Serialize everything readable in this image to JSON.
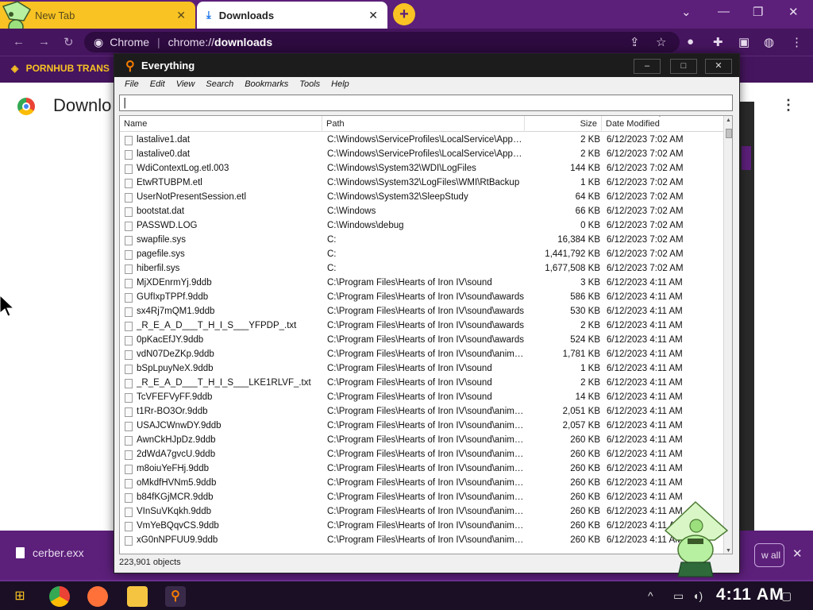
{
  "browser": {
    "tabs": [
      {
        "label": "New Tab"
      },
      {
        "label": "Downloads"
      }
    ],
    "omnibox": {
      "scheme_label": "Chrome",
      "url_prefix": "chrome://",
      "url_host": "downloads"
    },
    "bookmark_label": "PORNHUB TRANS",
    "page_title": "Downlo",
    "download_shelf": {
      "filename": "cerber.exx",
      "show_all_label": "w all"
    }
  },
  "everything": {
    "title": "Everything",
    "menu": [
      "File",
      "Edit",
      "View",
      "Search",
      "Bookmarks",
      "Tools",
      "Help"
    ],
    "search_value": "",
    "columns": {
      "name": "Name",
      "path": "Path",
      "size": "Size",
      "date": "Date Modified"
    },
    "rows": [
      {
        "name": "lastalive1.dat",
        "path": "C:\\Windows\\ServiceProfiles\\LocalService\\AppDat...",
        "size": "2 KB",
        "date": "6/12/2023 7:02 AM"
      },
      {
        "name": "lastalive0.dat",
        "path": "C:\\Windows\\ServiceProfiles\\LocalService\\AppDat...",
        "size": "2 KB",
        "date": "6/12/2023 7:02 AM"
      },
      {
        "name": "WdiContextLog.etl.003",
        "path": "C:\\Windows\\System32\\WDI\\LogFiles",
        "size": "144 KB",
        "date": "6/12/2023 7:02 AM"
      },
      {
        "name": "EtwRTUBPM.etl",
        "path": "C:\\Windows\\System32\\LogFiles\\WMI\\RtBackup",
        "size": "1 KB",
        "date": "6/12/2023 7:02 AM"
      },
      {
        "name": "UserNotPresentSession.etl",
        "path": "C:\\Windows\\System32\\SleepStudy",
        "size": "64 KB",
        "date": "6/12/2023 7:02 AM"
      },
      {
        "name": "bootstat.dat",
        "path": "C:\\Windows",
        "size": "66 KB",
        "date": "6/12/2023 7:02 AM"
      },
      {
        "name": "PASSWD.LOG",
        "path": "C:\\Windows\\debug",
        "size": "0 KB",
        "date": "6/12/2023 7:02 AM"
      },
      {
        "name": "swapfile.sys",
        "path": "C:",
        "size": "16,384 KB",
        "date": "6/12/2023 7:02 AM"
      },
      {
        "name": "pagefile.sys",
        "path": "C:",
        "size": "1,441,792 KB",
        "date": "6/12/2023 7:02 AM"
      },
      {
        "name": "hiberfil.sys",
        "path": "C:",
        "size": "1,677,508 KB",
        "date": "6/12/2023 7:02 AM"
      },
      {
        "name": "MjXDEnrmYj.9ddb",
        "path": "C:\\Program Files\\Hearts of Iron IV\\sound",
        "size": "3 KB",
        "date": "6/12/2023 4:11 AM"
      },
      {
        "name": "GUfIxpTPPf.9ddb",
        "path": "C:\\Program Files\\Hearts of Iron IV\\sound\\awards",
        "size": "586 KB",
        "date": "6/12/2023 4:11 AM"
      },
      {
        "name": "sx4Rj7mQM1.9ddb",
        "path": "C:\\Program Files\\Hearts of Iron IV\\sound\\awards",
        "size": "530 KB",
        "date": "6/12/2023 4:11 AM"
      },
      {
        "name": "_R_E_A_D___T_H_I_S___YFPDP_.txt",
        "path": "C:\\Program Files\\Hearts of Iron IV\\sound\\awards",
        "size": "2 KB",
        "date": "6/12/2023 4:11 AM"
      },
      {
        "name": "0pKacEfJY.9ddb",
        "path": "C:\\Program Files\\Hearts of Iron IV\\sound\\awards",
        "size": "524 KB",
        "date": "6/12/2023 4:11 AM"
      },
      {
        "name": "vdN07DeZKp.9ddb",
        "path": "C:\\Program Files\\Hearts of Iron IV\\sound\\animati...",
        "size": "1,781 KB",
        "date": "6/12/2023 4:11 AM"
      },
      {
        "name": "bSpLpuyNeX.9ddb",
        "path": "C:\\Program Files\\Hearts of Iron IV\\sound",
        "size": "1 KB",
        "date": "6/12/2023 4:11 AM"
      },
      {
        "name": "_R_E_A_D___T_H_I_S___LKE1RLVF_.txt",
        "path": "C:\\Program Files\\Hearts of Iron IV\\sound",
        "size": "2 KB",
        "date": "6/12/2023 4:11 AM"
      },
      {
        "name": "TcVFEFVyFF.9ddb",
        "path": "C:\\Program Files\\Hearts of Iron IV\\sound",
        "size": "14 KB",
        "date": "6/12/2023 4:11 AM"
      },
      {
        "name": "t1Rr-BO3Or.9ddb",
        "path": "C:\\Program Files\\Hearts of Iron IV\\sound\\animati...",
        "size": "2,051 KB",
        "date": "6/12/2023 4:11 AM"
      },
      {
        "name": "USAJCWnwDY.9ddb",
        "path": "C:\\Program Files\\Hearts of Iron IV\\sound\\animati...",
        "size": "2,057 KB",
        "date": "6/12/2023 4:11 AM"
      },
      {
        "name": "AwnCkHJpDz.9ddb",
        "path": "C:\\Program Files\\Hearts of Iron IV\\sound\\animati...",
        "size": "260 KB",
        "date": "6/12/2023 4:11 AM"
      },
      {
        "name": "2dWdA7gvcU.9ddb",
        "path": "C:\\Program Files\\Hearts of Iron IV\\sound\\animati...",
        "size": "260 KB",
        "date": "6/12/2023 4:11 AM"
      },
      {
        "name": "m8oiuYeFHj.9ddb",
        "path": "C:\\Program Files\\Hearts of Iron IV\\sound\\animati...",
        "size": "260 KB",
        "date": "6/12/2023 4:11 AM"
      },
      {
        "name": "oMkdfHVNm5.9ddb",
        "path": "C:\\Program Files\\Hearts of Iron IV\\sound\\animati...",
        "size": "260 KB",
        "date": "6/12/2023 4:11 AM"
      },
      {
        "name": "b84fKGjMCR.9ddb",
        "path": "C:\\Program Files\\Hearts of Iron IV\\sound\\animati...",
        "size": "260 KB",
        "date": "6/12/2023 4:11 AM"
      },
      {
        "name": "VInSuVKqkh.9ddb",
        "path": "C:\\Program Files\\Hearts of Iron IV\\sound\\animati...",
        "size": "260 KB",
        "date": "6/12/2023 4:11 AM"
      },
      {
        "name": "VmYeBQqvCS.9ddb",
        "path": "C:\\Program Files\\Hearts of Iron IV\\sound\\animati...",
        "size": "260 KB",
        "date": "6/12/2023 4:11 AM"
      },
      {
        "name": "xG0nNPFUU9.9ddb",
        "path": "C:\\Program Files\\Hearts of Iron IV\\sound\\animati...",
        "size": "260 KB",
        "date": "6/12/2023 4:11 AM"
      }
    ],
    "status": "223,901 objects"
  },
  "taskbar": {
    "clock": "4:11 AM"
  },
  "icons": {
    "search": "search-icon",
    "file": "file-icon",
    "close": "close-icon"
  },
  "colors": {
    "theme_purple": "#5c1f7a",
    "theme_yellow": "#f8c323",
    "everything_titlebar": "#1c1c1c"
  }
}
